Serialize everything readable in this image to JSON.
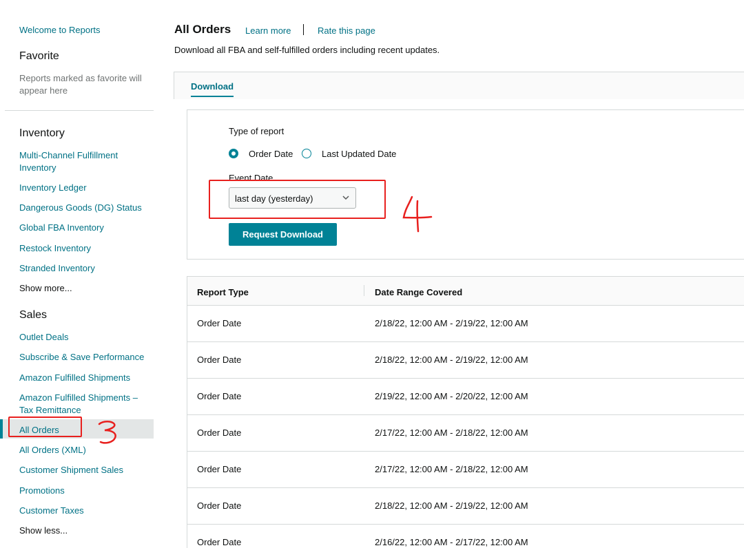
{
  "sidebar": {
    "welcome": "Welcome to Reports",
    "favorite_heading": "Favorite",
    "favorite_note": "Reports marked as favorite will appear here",
    "inventory_heading": "Inventory",
    "inventory_items": [
      "Multi-Channel Fulfillment Inventory",
      "Inventory Ledger",
      "Dangerous Goods (DG) Status",
      "Global FBA Inventory",
      "Restock Inventory",
      "Stranded Inventory"
    ],
    "show_more": "Show more...",
    "sales_heading": "Sales",
    "sales_items": [
      "Outlet Deals",
      "Subscribe & Save Performance",
      "Amazon Fulfilled Shipments",
      "Amazon Fulfilled Shipments – Tax Remittance",
      "All Orders",
      "All Orders (XML)",
      "Customer Shipment Sales",
      "Promotions",
      "Customer Taxes"
    ],
    "active_item": "All Orders",
    "show_less": "Show less..."
  },
  "header": {
    "title": "All Orders",
    "learn_more": "Learn more",
    "rate_page": "Rate this page",
    "subtitle": "Download all FBA and self-fulfilled orders including recent updates."
  },
  "tabs": [
    {
      "label": "Download",
      "active": true
    }
  ],
  "form": {
    "type_label": "Type of report",
    "options": [
      {
        "label": "Order Date",
        "checked": true
      },
      {
        "label": "Last Updated Date",
        "checked": false
      }
    ],
    "event_date_label": "Event Date",
    "event_date_value": "last day (yesterday)",
    "request_button": "Request Download"
  },
  "table": {
    "headers": [
      "Report Type",
      "Date Range Covered"
    ],
    "rows": [
      [
        "Order Date",
        "2/18/22, 12:00 AM - 2/19/22, 12:00 AM"
      ],
      [
        "Order Date",
        "2/18/22, 12:00 AM - 2/19/22, 12:00 AM"
      ],
      [
        "Order Date",
        "2/19/22, 12:00 AM - 2/20/22, 12:00 AM"
      ],
      [
        "Order Date",
        "2/17/22, 12:00 AM - 2/18/22, 12:00 AM"
      ],
      [
        "Order Date",
        "2/17/22, 12:00 AM - 2/18/22, 12:00 AM"
      ],
      [
        "Order Date",
        "2/18/22, 12:00 AM - 2/19/22, 12:00 AM"
      ],
      [
        "Order Date",
        "2/16/22, 12:00 AM - 2/17/22, 12:00 AM"
      ]
    ]
  },
  "colors": {
    "accent": "#008296",
    "link": "#007185",
    "annotation": "#e8201e"
  },
  "annotations": {
    "sidebar_mark": "3",
    "dropdown_mark": "4"
  }
}
